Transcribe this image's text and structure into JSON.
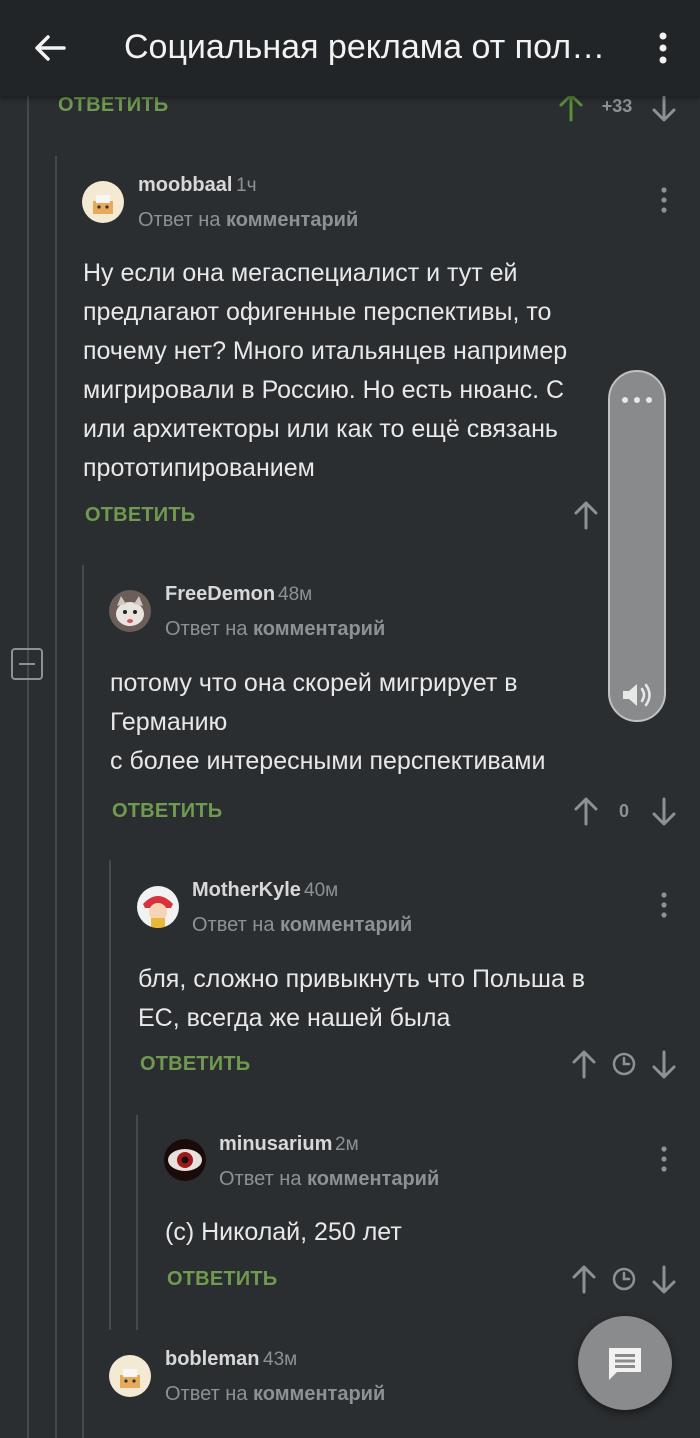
{
  "header": {
    "title": "Социальная реклама от пол…",
    "back_icon": "arrow-left-icon",
    "menu_icon": "more-vertical-icon"
  },
  "colors": {
    "background": "#2b2e31",
    "header": "#222527",
    "reply_green": "#6f9a4f",
    "upvote_active": "#5a8f3c",
    "muted": "#8d9195"
  },
  "top_actions": {
    "reply_label": "ОТВЕТИТЬ",
    "score": "+33"
  },
  "comments": [
    {
      "author": "moobbaal",
      "time": "1ч",
      "reply_prefix": "Ответ на",
      "reply_target": "комментарий",
      "lines": [
        "Ну если она мегаспециалист и тут ей",
        "предлагают офигенные перспективы, то",
        "почему нет? Много итальянцев например",
        "мигрировали в Россию. Но есть нюанс. С",
        "или архитекторы или как то ещё связань",
        "прототипированием"
      ],
      "reply_label": "ОТВЕТИТЬ"
    },
    {
      "author": "FreeDemon",
      "time": "48м",
      "reply_prefix": "Ответ на",
      "reply_target": "комментарий",
      "lines": [
        "потому что она скорей мигрирует в",
        "Германию",
        "с более интересными перспективами"
      ],
      "reply_label": "ОТВЕТИТЬ",
      "score": "0"
    },
    {
      "author": "MotherKyle",
      "time": "40м",
      "reply_prefix": "Ответ на",
      "reply_target": "комментарий",
      "lines": [
        "бля, сложно привыкнуть что Польша в",
        "ЕС, всегда же нашей была"
      ],
      "reply_label": "ОТВЕТИТЬ"
    },
    {
      "author": "minusarium",
      "time": "2м",
      "reply_prefix": "Ответ на",
      "reply_target": "комментарий",
      "lines": [
        "(с) Николай, 250 лет"
      ],
      "reply_label": "ОТВЕТИТЬ"
    },
    {
      "author": "bobleman",
      "time": "43м",
      "reply_prefix": "Ответ на",
      "reply_target": "комментарий"
    }
  ],
  "floating_panel": {
    "dots_icon": "more-horizontal-icon",
    "volume_icon": "volume-icon"
  },
  "fab": {
    "icon": "comment-icon"
  }
}
